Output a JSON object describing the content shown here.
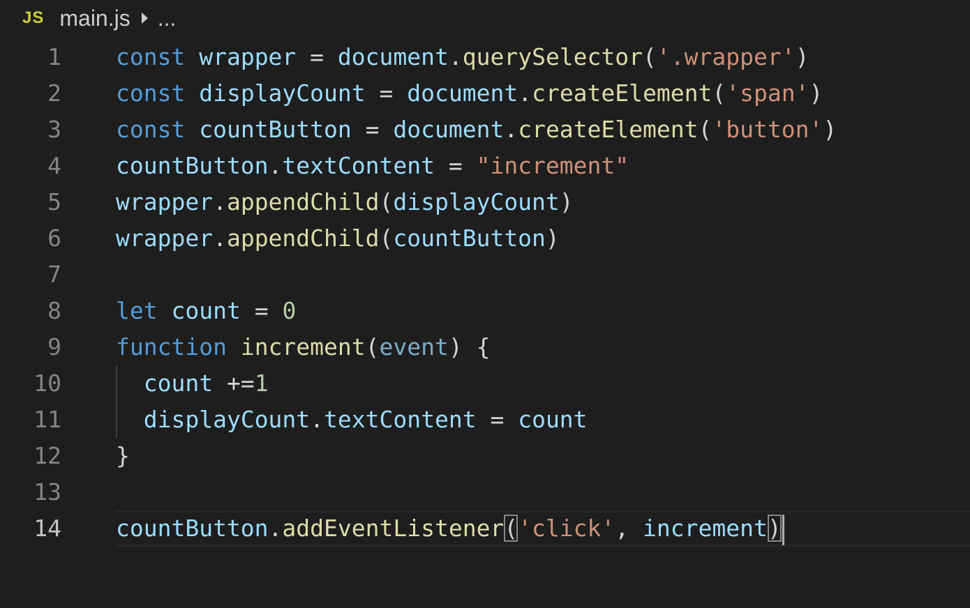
{
  "breadcrumb": {
    "file_icon_label": "JS",
    "file_name": "main.js",
    "more": "..."
  },
  "editor": {
    "current_line": 14,
    "lines": [
      {
        "num": "1",
        "tokens": [
          {
            "t": "const",
            "c": "kw"
          },
          {
            "t": " ",
            "c": "pun"
          },
          {
            "t": "wrapper",
            "c": "var"
          },
          {
            "t": " = ",
            "c": "pun"
          },
          {
            "t": "document",
            "c": "var"
          },
          {
            "t": ".",
            "c": "pun"
          },
          {
            "t": "querySelector",
            "c": "fn"
          },
          {
            "t": "(",
            "c": "pun"
          },
          {
            "t": "'.wrapper'",
            "c": "str"
          },
          {
            "t": ")",
            "c": "pun"
          }
        ]
      },
      {
        "num": "2",
        "tokens": [
          {
            "t": "const",
            "c": "kw"
          },
          {
            "t": " ",
            "c": "pun"
          },
          {
            "t": "displayCount",
            "c": "var"
          },
          {
            "t": " = ",
            "c": "pun"
          },
          {
            "t": "document",
            "c": "var"
          },
          {
            "t": ".",
            "c": "pun"
          },
          {
            "t": "createElement",
            "c": "fn"
          },
          {
            "t": "(",
            "c": "pun"
          },
          {
            "t": "'span'",
            "c": "str"
          },
          {
            "t": ")",
            "c": "pun"
          }
        ]
      },
      {
        "num": "3",
        "tokens": [
          {
            "t": "const",
            "c": "kw"
          },
          {
            "t": " ",
            "c": "pun"
          },
          {
            "t": "countButton",
            "c": "var"
          },
          {
            "t": " = ",
            "c": "pun"
          },
          {
            "t": "document",
            "c": "var"
          },
          {
            "t": ".",
            "c": "pun"
          },
          {
            "t": "createElement",
            "c": "fn"
          },
          {
            "t": "(",
            "c": "pun"
          },
          {
            "t": "'button'",
            "c": "str"
          },
          {
            "t": ")",
            "c": "pun"
          }
        ]
      },
      {
        "num": "4",
        "tokens": [
          {
            "t": "countButton",
            "c": "var"
          },
          {
            "t": ".",
            "c": "pun"
          },
          {
            "t": "textContent",
            "c": "var"
          },
          {
            "t": " = ",
            "c": "pun"
          },
          {
            "t": "\"increment\"",
            "c": "str"
          }
        ]
      },
      {
        "num": "5",
        "tokens": [
          {
            "t": "wrapper",
            "c": "var"
          },
          {
            "t": ".",
            "c": "pun"
          },
          {
            "t": "appendChild",
            "c": "fn"
          },
          {
            "t": "(",
            "c": "pun"
          },
          {
            "t": "displayCount",
            "c": "var"
          },
          {
            "t": ")",
            "c": "pun"
          }
        ]
      },
      {
        "num": "6",
        "tokens": [
          {
            "t": "wrapper",
            "c": "var"
          },
          {
            "t": ".",
            "c": "pun"
          },
          {
            "t": "appendChild",
            "c": "fn"
          },
          {
            "t": "(",
            "c": "pun"
          },
          {
            "t": "countButton",
            "c": "var"
          },
          {
            "t": ")",
            "c": "pun"
          }
        ]
      },
      {
        "num": "7",
        "tokens": []
      },
      {
        "num": "8",
        "tokens": [
          {
            "t": "let",
            "c": "kw"
          },
          {
            "t": " ",
            "c": "pun"
          },
          {
            "t": "count",
            "c": "var"
          },
          {
            "t": " = ",
            "c": "pun"
          },
          {
            "t": "0",
            "c": "num"
          }
        ]
      },
      {
        "num": "9",
        "tokens": [
          {
            "t": "function",
            "c": "kw"
          },
          {
            "t": " ",
            "c": "pun"
          },
          {
            "t": "increment",
            "c": "fn"
          },
          {
            "t": "(",
            "c": "pun"
          },
          {
            "t": "event",
            "c": "param"
          },
          {
            "t": ") {",
            "c": "pun"
          }
        ]
      },
      {
        "num": "10",
        "indent": true,
        "tokens": [
          {
            "t": "  ",
            "c": "pun"
          },
          {
            "t": "count",
            "c": "var"
          },
          {
            "t": " +=",
            "c": "pun"
          },
          {
            "t": "1",
            "c": "num"
          }
        ]
      },
      {
        "num": "11",
        "indent": true,
        "tokens": [
          {
            "t": "  ",
            "c": "pun"
          },
          {
            "t": "displayCount",
            "c": "var"
          },
          {
            "t": ".",
            "c": "pun"
          },
          {
            "t": "textContent",
            "c": "var"
          },
          {
            "t": " = ",
            "c": "pun"
          },
          {
            "t": "count",
            "c": "var"
          }
        ]
      },
      {
        "num": "12",
        "tokens": [
          {
            "t": "}",
            "c": "pun"
          }
        ]
      },
      {
        "num": "13",
        "tokens": []
      },
      {
        "num": "14",
        "tokens": [
          {
            "t": "countButton",
            "c": "var"
          },
          {
            "t": ".",
            "c": "pun"
          },
          {
            "t": "addEventListener",
            "c": "fn"
          },
          {
            "t": "(",
            "c": "pun",
            "match": true
          },
          {
            "t": "'click'",
            "c": "str"
          },
          {
            "t": ", ",
            "c": "pun"
          },
          {
            "t": "increment",
            "c": "var"
          },
          {
            "t": ")",
            "c": "pun",
            "match": true
          }
        ]
      }
    ]
  }
}
